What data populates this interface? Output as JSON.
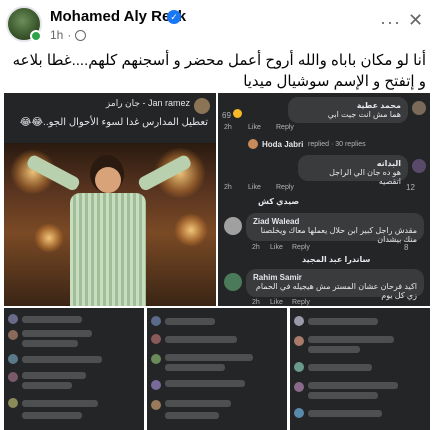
{
  "post": {
    "author": "Mohamed Aly Rezk",
    "time": "1h",
    "separator": "·",
    "caption": "أنا لو مكان باباه والله أروح أعمل محضر و أسجنهم كلهم....غطا بلاعه و إتفتح و الإسم سوشيال ميديا",
    "more_label": "···",
    "close_label": "✕",
    "verified_glyph": "✓"
  },
  "tiles": {
    "main": {
      "poster_name": "Jan ramez - جان رامز",
      "poster_text": "تعطيل المدارس غدا لسوء الأحوال الجو..😂😂"
    },
    "right": {
      "comments": [
        {
          "name": "محمد عطية",
          "text": "هما مش انت جيت ابي",
          "time": "2h",
          "like": "Like",
          "reply": "Reply",
          "count": "69"
        },
        {
          "name": "Hoda Jabri",
          "text": "replied · 30 replies",
          "time": "",
          "like": "",
          "reply": "",
          "count": ""
        },
        {
          "name": "البدانه",
          "text": "هو ده جان الي الراجل اتقصيه",
          "time": "2h",
          "like": "Like",
          "reply": "Reply",
          "count": "12"
        },
        {
          "name": "صيدي كش",
          "text": "",
          "time": "",
          "like": "",
          "reply": "",
          "count": ""
        },
        {
          "name": "Ziad Walead",
          "text": "مقدش راجل كبير ابن حلال يعملها معاك ويخلصنا منك بيشدان",
          "time": "2h",
          "like": "Like",
          "reply": "Reply",
          "count": "8"
        },
        {
          "name": "ساندرا عبد المجيد",
          "text": "replied · 4 replies",
          "time": "",
          "like": "",
          "reply": "",
          "count": ""
        },
        {
          "name": "Rahim Samir",
          "text": "اكيد فرحان عشان المستر مش هيجيله في الحمام زي كل يوم",
          "time": "2h",
          "like": "Like",
          "reply": "Reply",
          "count": ""
        }
      ]
    }
  }
}
